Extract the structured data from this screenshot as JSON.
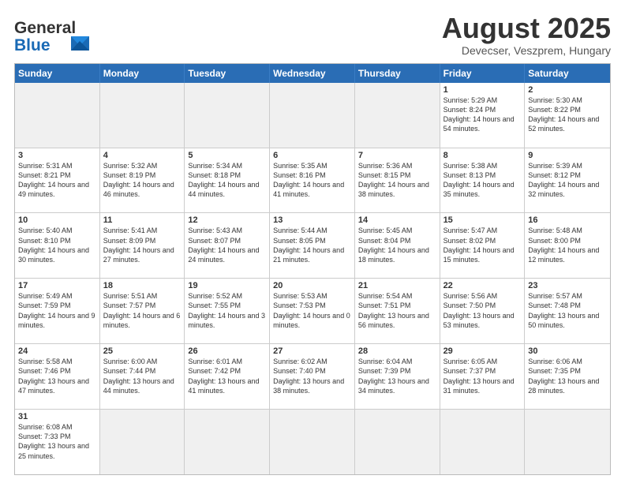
{
  "header": {
    "logo_general": "General",
    "logo_blue": "Blue",
    "month_title": "August 2025",
    "subtitle": "Devecser, Veszprem, Hungary"
  },
  "days_of_week": [
    "Sunday",
    "Monday",
    "Tuesday",
    "Wednesday",
    "Thursday",
    "Friday",
    "Saturday"
  ],
  "weeks": [
    [
      {
        "day": "",
        "empty": true
      },
      {
        "day": "",
        "empty": true
      },
      {
        "day": "",
        "empty": true
      },
      {
        "day": "",
        "empty": true
      },
      {
        "day": "",
        "empty": true
      },
      {
        "day": "1",
        "sunrise": "Sunrise: 5:29 AM",
        "sunset": "Sunset: 8:24 PM",
        "daylight": "Daylight: 14 hours and 54 minutes."
      },
      {
        "day": "2",
        "sunrise": "Sunrise: 5:30 AM",
        "sunset": "Sunset: 8:22 PM",
        "daylight": "Daylight: 14 hours and 52 minutes."
      }
    ],
    [
      {
        "day": "3",
        "sunrise": "Sunrise: 5:31 AM",
        "sunset": "Sunset: 8:21 PM",
        "daylight": "Daylight: 14 hours and 49 minutes."
      },
      {
        "day": "4",
        "sunrise": "Sunrise: 5:32 AM",
        "sunset": "Sunset: 8:19 PM",
        "daylight": "Daylight: 14 hours and 46 minutes."
      },
      {
        "day": "5",
        "sunrise": "Sunrise: 5:34 AM",
        "sunset": "Sunset: 8:18 PM",
        "daylight": "Daylight: 14 hours and 44 minutes."
      },
      {
        "day": "6",
        "sunrise": "Sunrise: 5:35 AM",
        "sunset": "Sunset: 8:16 PM",
        "daylight": "Daylight: 14 hours and 41 minutes."
      },
      {
        "day": "7",
        "sunrise": "Sunrise: 5:36 AM",
        "sunset": "Sunset: 8:15 PM",
        "daylight": "Daylight: 14 hours and 38 minutes."
      },
      {
        "day": "8",
        "sunrise": "Sunrise: 5:38 AM",
        "sunset": "Sunset: 8:13 PM",
        "daylight": "Daylight: 14 hours and 35 minutes."
      },
      {
        "day": "9",
        "sunrise": "Sunrise: 5:39 AM",
        "sunset": "Sunset: 8:12 PM",
        "daylight": "Daylight: 14 hours and 32 minutes."
      }
    ],
    [
      {
        "day": "10",
        "sunrise": "Sunrise: 5:40 AM",
        "sunset": "Sunset: 8:10 PM",
        "daylight": "Daylight: 14 hours and 30 minutes."
      },
      {
        "day": "11",
        "sunrise": "Sunrise: 5:41 AM",
        "sunset": "Sunset: 8:09 PM",
        "daylight": "Daylight: 14 hours and 27 minutes."
      },
      {
        "day": "12",
        "sunrise": "Sunrise: 5:43 AM",
        "sunset": "Sunset: 8:07 PM",
        "daylight": "Daylight: 14 hours and 24 minutes."
      },
      {
        "day": "13",
        "sunrise": "Sunrise: 5:44 AM",
        "sunset": "Sunset: 8:05 PM",
        "daylight": "Daylight: 14 hours and 21 minutes."
      },
      {
        "day": "14",
        "sunrise": "Sunrise: 5:45 AM",
        "sunset": "Sunset: 8:04 PM",
        "daylight": "Daylight: 14 hours and 18 minutes."
      },
      {
        "day": "15",
        "sunrise": "Sunrise: 5:47 AM",
        "sunset": "Sunset: 8:02 PM",
        "daylight": "Daylight: 14 hours and 15 minutes."
      },
      {
        "day": "16",
        "sunrise": "Sunrise: 5:48 AM",
        "sunset": "Sunset: 8:00 PM",
        "daylight": "Daylight: 14 hours and 12 minutes."
      }
    ],
    [
      {
        "day": "17",
        "sunrise": "Sunrise: 5:49 AM",
        "sunset": "Sunset: 7:59 PM",
        "daylight": "Daylight: 14 hours and 9 minutes."
      },
      {
        "day": "18",
        "sunrise": "Sunrise: 5:51 AM",
        "sunset": "Sunset: 7:57 PM",
        "daylight": "Daylight: 14 hours and 6 minutes."
      },
      {
        "day": "19",
        "sunrise": "Sunrise: 5:52 AM",
        "sunset": "Sunset: 7:55 PM",
        "daylight": "Daylight: 14 hours and 3 minutes."
      },
      {
        "day": "20",
        "sunrise": "Sunrise: 5:53 AM",
        "sunset": "Sunset: 7:53 PM",
        "daylight": "Daylight: 14 hours and 0 minutes."
      },
      {
        "day": "21",
        "sunrise": "Sunrise: 5:54 AM",
        "sunset": "Sunset: 7:51 PM",
        "daylight": "Daylight: 13 hours and 56 minutes."
      },
      {
        "day": "22",
        "sunrise": "Sunrise: 5:56 AM",
        "sunset": "Sunset: 7:50 PM",
        "daylight": "Daylight: 13 hours and 53 minutes."
      },
      {
        "day": "23",
        "sunrise": "Sunrise: 5:57 AM",
        "sunset": "Sunset: 7:48 PM",
        "daylight": "Daylight: 13 hours and 50 minutes."
      }
    ],
    [
      {
        "day": "24",
        "sunrise": "Sunrise: 5:58 AM",
        "sunset": "Sunset: 7:46 PM",
        "daylight": "Daylight: 13 hours and 47 minutes."
      },
      {
        "day": "25",
        "sunrise": "Sunrise: 6:00 AM",
        "sunset": "Sunset: 7:44 PM",
        "daylight": "Daylight: 13 hours and 44 minutes."
      },
      {
        "day": "26",
        "sunrise": "Sunrise: 6:01 AM",
        "sunset": "Sunset: 7:42 PM",
        "daylight": "Daylight: 13 hours and 41 minutes."
      },
      {
        "day": "27",
        "sunrise": "Sunrise: 6:02 AM",
        "sunset": "Sunset: 7:40 PM",
        "daylight": "Daylight: 13 hours and 38 minutes."
      },
      {
        "day": "28",
        "sunrise": "Sunrise: 6:04 AM",
        "sunset": "Sunset: 7:39 PM",
        "daylight": "Daylight: 13 hours and 34 minutes."
      },
      {
        "day": "29",
        "sunrise": "Sunrise: 6:05 AM",
        "sunset": "Sunset: 7:37 PM",
        "daylight": "Daylight: 13 hours and 31 minutes."
      },
      {
        "day": "30",
        "sunrise": "Sunrise: 6:06 AM",
        "sunset": "Sunset: 7:35 PM",
        "daylight": "Daylight: 13 hours and 28 minutes."
      }
    ],
    [
      {
        "day": "31",
        "sunrise": "Sunrise: 6:08 AM",
        "sunset": "Sunset: 7:33 PM",
        "daylight": "Daylight: 13 hours and 25 minutes."
      },
      {
        "day": "",
        "empty": true
      },
      {
        "day": "",
        "empty": true
      },
      {
        "day": "",
        "empty": true
      },
      {
        "day": "",
        "empty": true
      },
      {
        "day": "",
        "empty": true
      },
      {
        "day": "",
        "empty": true
      }
    ]
  ]
}
